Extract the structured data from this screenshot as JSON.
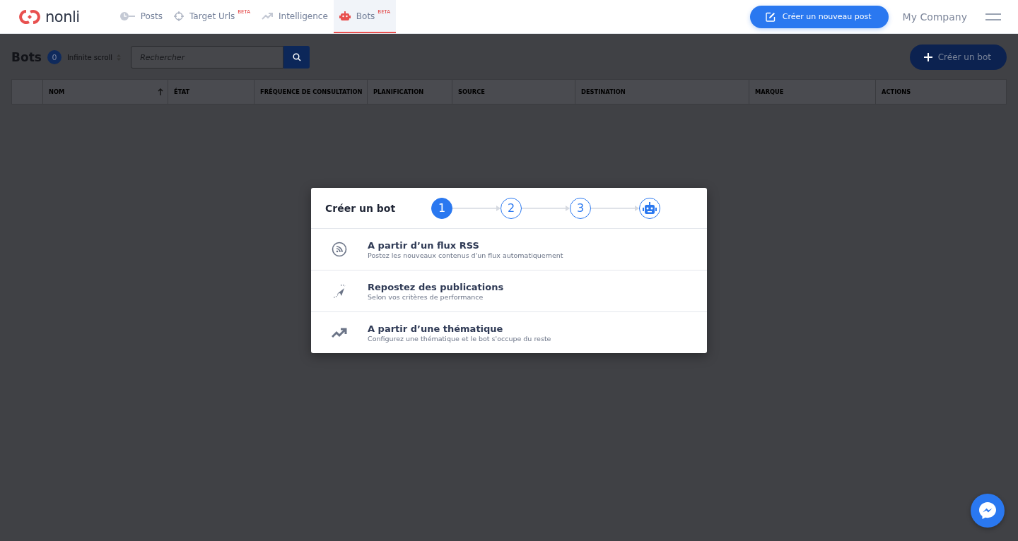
{
  "nav": {
    "brand": "nonli",
    "items": [
      {
        "label": "Posts",
        "selected": false
      },
      {
        "label": "Target Urls",
        "badge": "BETA",
        "selected": false
      },
      {
        "label": "Intelligence",
        "selected": false
      },
      {
        "label": "Bots",
        "badge": "BETA",
        "selected": true
      }
    ],
    "create_button": "Créer un nouveau post",
    "company": "My Company"
  },
  "toolbar": {
    "title": "Bots",
    "count": "0",
    "scroll_mode": "Infinite scroll",
    "search": {
      "placeholder": "Rechercher"
    },
    "create_button": "Créer un bot"
  },
  "table": {
    "columns": [
      {
        "label": "NOM",
        "sorted": true
      },
      {
        "label": "ÉTAT",
        "sorted": false
      },
      {
        "label": "FRÉQUENCE DE CONSULTATION",
        "sorted": false
      },
      {
        "label": "PLANIFICATION",
        "sorted": false
      },
      {
        "label": "SOURCE",
        "sorted": false
      },
      {
        "label": "DESTINATION",
        "sorted": false
      },
      {
        "label": "MARQUE",
        "sorted": false
      },
      {
        "label": "ACTIONS",
        "sorted": false
      }
    ]
  },
  "modal": {
    "title": "Créer un bot",
    "steps": [
      {
        "kind": "number",
        "label": "1",
        "selected": true
      },
      {
        "kind": "number",
        "label": "2",
        "selected": false
      },
      {
        "kind": "number",
        "label": "3",
        "selected": false
      },
      {
        "kind": "robot",
        "selected": false
      }
    ],
    "options": [
      {
        "kind": "rss",
        "title": "A partir d’un flux RSS",
        "subtitle": "Postez les nouveaux contenus d'un flux automatiquement"
      },
      {
        "kind": "repost",
        "title": "Repostez des publications",
        "subtitle": "Selon vos critères de performance"
      },
      {
        "kind": "trend",
        "title": "A partir d’une thématique",
        "subtitle": "Configurez une thématique et le bot s'occupe du reste"
      }
    ]
  }
}
